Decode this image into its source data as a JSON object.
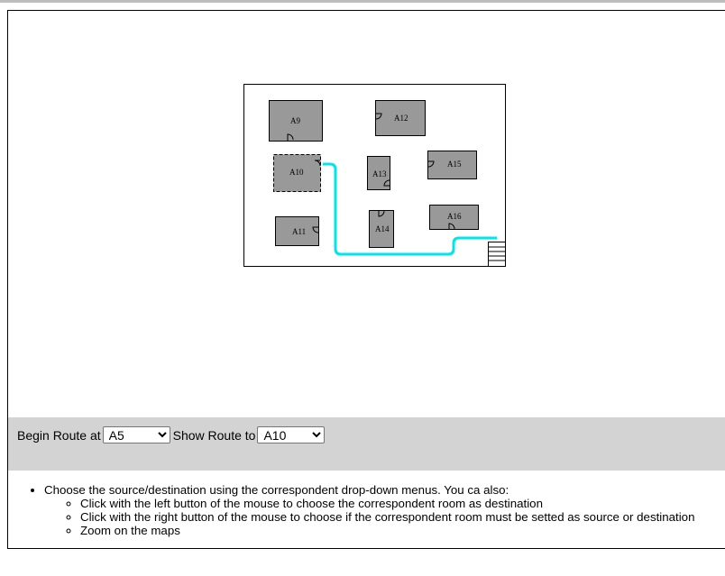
{
  "map": {
    "rooms": [
      {
        "id": "A9",
        "label": "A9"
      },
      {
        "id": "A10",
        "label": "A10",
        "selected": true
      },
      {
        "id": "A11",
        "label": "A11"
      },
      {
        "id": "A12",
        "label": "A12"
      },
      {
        "id": "A13",
        "label": "A13"
      },
      {
        "id": "A14",
        "label": "A14"
      },
      {
        "id": "A15",
        "label": "A15"
      },
      {
        "id": "A16",
        "label": "A16"
      }
    ],
    "route_color": "#00e5ee",
    "room_fill": "#999999"
  },
  "route": {
    "begin_label": "Begin Route at",
    "begin_value": "A5",
    "show_label": "Show Route to",
    "show_value": "A10"
  },
  "help": {
    "main": "Choose the source/destination using the correspondent drop-down menus. You ca also:",
    "items": [
      "Click with the left button of the mouse to choose the correspondent room as destination",
      "Click with the right button of the mouse to choose if the correspondent room must be setted as source or destination",
      "Zoom on the maps"
    ]
  }
}
